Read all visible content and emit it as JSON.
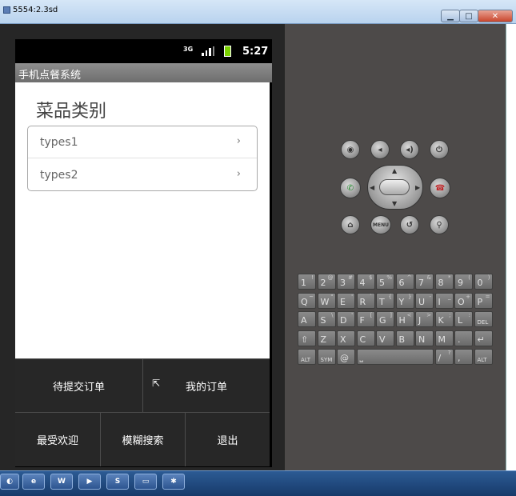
{
  "window": {
    "title": "5554:2.3sd",
    "min": "▁",
    "max": "□",
    "close": "✕"
  },
  "status": {
    "network": "3G",
    "time": "5:27"
  },
  "app": {
    "title": "手机点餐系统",
    "heading": "菜品类别"
  },
  "list": [
    {
      "label": "types1",
      "chevron": "›"
    },
    {
      "label": "types2",
      "chevron": "›"
    }
  ],
  "menu": {
    "pending_orders": "待提交订单",
    "my_orders": "我的订单",
    "favorites": "最受欢迎",
    "fuzzy_search": "模糊搜索",
    "exit": "退出"
  },
  "controls": {
    "menu_label": "MENU"
  },
  "keyboard": {
    "row1": [
      [
        "1",
        "!"
      ],
      [
        "2",
        "@"
      ],
      [
        "3",
        "#"
      ],
      [
        "4",
        "$"
      ],
      [
        "5",
        "%"
      ],
      [
        "6",
        "^"
      ],
      [
        "7",
        "&"
      ],
      [
        "8",
        "*"
      ],
      [
        "9",
        "("
      ],
      [
        "0",
        ")"
      ]
    ],
    "row2": [
      [
        "Q",
        "~"
      ],
      [
        "W",
        "\""
      ],
      [
        "E",
        "'"
      ],
      [
        "R",
        "`"
      ],
      [
        "T",
        "{"
      ],
      [
        "Y",
        "}"
      ],
      [
        "U",
        "-"
      ],
      [
        "I",
        "_"
      ],
      [
        "O",
        "+"
      ],
      [
        "P",
        "="
      ]
    ],
    "row3": [
      [
        "A",
        ""
      ],
      [
        "S",
        "\\"
      ],
      [
        "D",
        "'"
      ],
      [
        "F",
        "["
      ],
      [
        "G",
        "]"
      ],
      [
        "H",
        "<"
      ],
      [
        "J",
        ">"
      ],
      [
        "K",
        ";"
      ],
      [
        "L",
        ":"
      ],
      [
        "DEL",
        ""
      ]
    ],
    "row4": [
      [
        "⇧",
        ""
      ],
      [
        "Z",
        ""
      ],
      [
        "X",
        ""
      ],
      [
        "C",
        ""
      ],
      [
        "V",
        ""
      ],
      [
        "B",
        ""
      ],
      [
        "N",
        ""
      ],
      [
        "M",
        ""
      ],
      [
        ".",
        ""
      ],
      [
        "↵",
        ""
      ]
    ],
    "row5": [
      [
        "ALT",
        ""
      ],
      [
        "SYM",
        ""
      ],
      [
        "@",
        ""
      ],
      [
        "⎵",
        ""
      ],
      [
        "/",
        "?"
      ],
      [
        ",",
        ""
      ],
      [
        "ALT",
        ""
      ]
    ]
  },
  "taskbar": {
    "word_icon": "W"
  }
}
